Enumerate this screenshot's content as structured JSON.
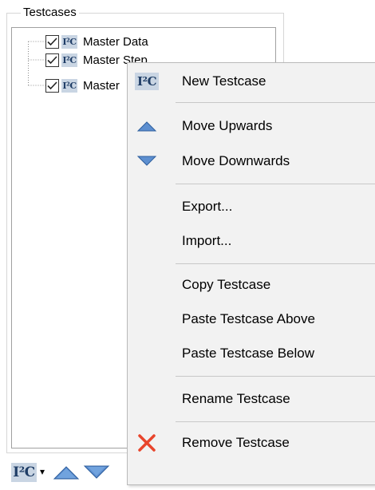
{
  "group": {
    "title": "Testcases"
  },
  "tree": {
    "items": [
      {
        "label": "Master Data",
        "checked": true
      },
      {
        "label": "Master Step",
        "checked": true
      },
      {
        "label": "Master",
        "checked": true
      }
    ]
  },
  "icons": {
    "testcase": "I²C",
    "accent_blue": "#3f7bbf",
    "remove_red": "#e8452c"
  },
  "menu": {
    "items": [
      {
        "label": "New Testcase",
        "icon": "testcase-icon"
      },
      {
        "label": "Move Upwards",
        "icon": "triangle-up-icon"
      },
      {
        "label": "Move Downwards",
        "icon": "triangle-down-icon"
      },
      {
        "label": "Export...",
        "icon": ""
      },
      {
        "label": "Import...",
        "icon": ""
      },
      {
        "label": "Copy Testcase",
        "icon": ""
      },
      {
        "label": "Paste Testcase Above",
        "icon": ""
      },
      {
        "label": "Paste Testcase Below",
        "icon": ""
      },
      {
        "label": "Rename Testcase",
        "icon": ""
      },
      {
        "label": "Remove Testcase",
        "icon": "remove-x-icon"
      }
    ]
  },
  "toolbar": {
    "dropdown_glyph": "▾"
  }
}
